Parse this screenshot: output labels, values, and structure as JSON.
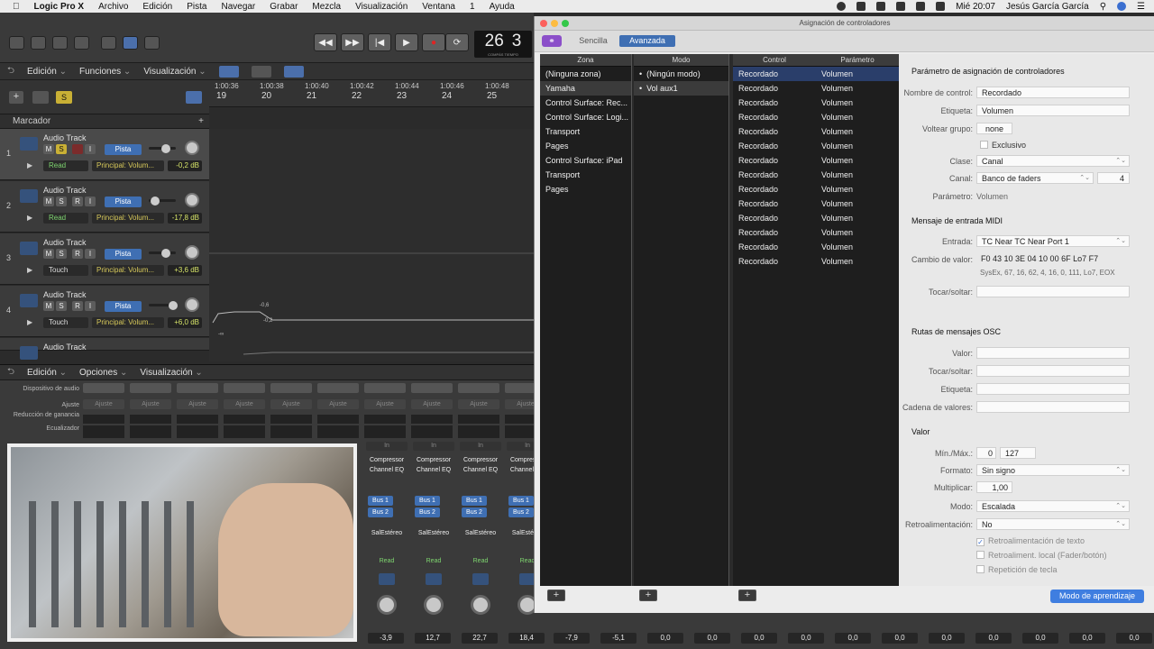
{
  "menubar": {
    "apple": "",
    "items": [
      "Logic Pro X",
      "Archivo",
      "Edición",
      "Pista",
      "Navegar",
      "Grabar",
      "Mezcla",
      "Visualización",
      "Ventana",
      "1",
      "Ayuda"
    ],
    "clock": "Mié 20:07",
    "user": "Jesús García García"
  },
  "transport": {
    "lcd_bar": "26",
    "lcd_beat": "3",
    "lcd_sub": "COMPÁS   TIEMPO"
  },
  "edit_bar": {
    "menus": [
      "Edición",
      "Funciones",
      "Visualización"
    ]
  },
  "ruler": {
    "times": [
      "1:00:36",
      "1:00:38",
      "1:00:40",
      "1:00:42",
      "1:00:44",
      "1:00:46",
      "1:00:48"
    ],
    "bars": [
      "19",
      "20",
      "21",
      "22",
      "23",
      "24",
      "25"
    ]
  },
  "marker": "Marcador",
  "tracks": [
    {
      "num": "1",
      "name": "Audio Track",
      "m": "M",
      "s": "S",
      "r": "",
      "i": "I",
      "pista": "Pista",
      "auto": "Read",
      "param": "Principal: Volum...",
      "db": "-0,2 dB"
    },
    {
      "num": "2",
      "name": "Audio Track",
      "m": "M",
      "s": "S",
      "r": "R",
      "i": "I",
      "pista": "Pista",
      "auto": "Read",
      "param": "Principal: Volum...",
      "db": "-17,8 dB"
    },
    {
      "num": "3",
      "name": "Audio Track",
      "m": "M",
      "s": "S",
      "r": "R",
      "i": "I",
      "pista": "Pista",
      "auto": "Touch",
      "param": "Principal: Volum...",
      "db": "+3,6 dB"
    },
    {
      "num": "4",
      "name": "Audio Track",
      "m": "M",
      "s": "S",
      "r": "R",
      "i": "I",
      "pista": "Pista",
      "auto": "Touch",
      "param": "Principal: Volum...",
      "db": "+6,0 dB"
    },
    {
      "name": "Audio Track"
    }
  ],
  "automation": {
    "a": "-0,6",
    "b": "-0,2",
    "c": "-∞"
  },
  "mixer_bar": {
    "menus": [
      "Edición",
      "Opciones",
      "Visualización"
    ]
  },
  "mixer": {
    "labels": [
      "Dispositivo de audio",
      "Ajuste",
      "Reducción de ganancia",
      "Ecualizador"
    ],
    "ajuste": "Ajuste",
    "in": "In",
    "strips": [
      {
        "ins1": "Compressor",
        "ins2": "Channel EQ",
        "bus1": "Bus 1",
        "bus2": "Bus 2",
        "out": "SalEstéreo",
        "auto": "Read",
        "val": "-3,9"
      },
      {
        "ins1": "Compressor",
        "ins2": "Channel EQ",
        "bus1": "Bus 1",
        "bus2": "Bus 2",
        "out": "SalEstéreo",
        "auto": "Read",
        "val": "12,7"
      },
      {
        "ins1": "Compressor",
        "ins2": "Channel EQ",
        "bus1": "Bus 1",
        "bus2": "Bus 2",
        "out": "SalEstéreo",
        "auto": "Read",
        "val": "22,7"
      },
      {
        "ins1": "Compressor",
        "ins2": "Channel EQ",
        "bus1": "Bus 1",
        "bus2": "Bus 2",
        "out": "SalEstéreo",
        "auto": "Read",
        "val": "18,4"
      }
    ],
    "bottom_vals": [
      "-7,9",
      "-5,1",
      "0,0",
      "0,0",
      "0,0",
      "0,0",
      "0,0",
      "0,0",
      "0,0",
      "0,0",
      "0,0",
      "0,0",
      "0,0"
    ]
  },
  "dialog": {
    "title": "Asignación de controladores",
    "tab_simple": "Sencilla",
    "tab_advanced": "Avanzada",
    "col_zona": "Zona",
    "col_modo": "Modo",
    "col_control": "Control",
    "col_param": "Parámetro",
    "zonas": [
      "(Ninguna zona)",
      "Yamaha",
      "Control Surface: Rec...",
      "Control Surface: Logi...",
      "Transport",
      "Pages",
      "Control Surface: iPad",
      "Transport",
      "Pages"
    ],
    "modos": [
      "(Ningún modo)",
      "Vol aux1"
    ],
    "controls": [
      "Recordado",
      "Recordado",
      "Recordado",
      "Recordado",
      "Recordado",
      "Recordado",
      "Recordado",
      "Recordado",
      "Recordado",
      "Recordado",
      "Recordado",
      "Recordado",
      "Recordado",
      "Recordado"
    ],
    "params": [
      "Volumen",
      "Volumen",
      "Volumen",
      "Volumen",
      "Volumen",
      "Volumen",
      "Volumen",
      "Volumen",
      "Volumen",
      "Volumen",
      "Volumen",
      "Volumen",
      "Volumen",
      "Volumen"
    ],
    "plus": "+",
    "p": {
      "h1": "Parámetro de asignación de controladores",
      "l_nombre": "Nombre de control:",
      "v_nombre": "Recordado",
      "l_etiqueta": "Etiqueta:",
      "v_etiqueta": "Volumen",
      "l_voltear": "Voltear grupo:",
      "v_voltear": "none",
      "l_excl": "Exclusivo",
      "l_clase": "Clase:",
      "v_clase": "Canal",
      "l_canal": "Canal:",
      "v_canal": "Banco de faders",
      "v_canal_n": "4",
      "l_param": "Parámetro:",
      "v_param": "Volumen",
      "h2": "Mensaje de entrada MIDI",
      "l_entrada": "Entrada:",
      "v_entrada": "TC Near TC Near Port 1",
      "l_cambio": "Cambio de valor:",
      "v_cambio": "F0 43 10 3E 04 10 00 6F Lo7 F7",
      "v_sysex": "SysEx, 67, 16, 62, 4, 16, 0, 111, Lo7, EOX",
      "l_tocar": "Tocar/soltar:",
      "h3": "Rutas de mensajes OSC",
      "l_valor": "Valor:",
      "l_tocar2": "Tocar/soltar:",
      "l_etiq2": "Etiqueta:",
      "l_cadena": "Cadena de valores:",
      "h4": "Valor",
      "l_minmax": "Mín./Máx.:",
      "v_min": "0",
      "v_max": "127",
      "l_formato": "Formato:",
      "v_formato": "Sin signo",
      "l_mult": "Multiplicar:",
      "v_mult": "1,00",
      "l_modo": "Modo:",
      "v_modo": "Escalada",
      "l_retro": "Retroalimentación:",
      "v_retro": "No",
      "c_texto": "Retroalimentación de texto",
      "c_local": "Retroaliment. local (Fader/botón)",
      "c_rep": "Repetición de tecla"
    },
    "learn": "Modo de aprendizaje"
  }
}
